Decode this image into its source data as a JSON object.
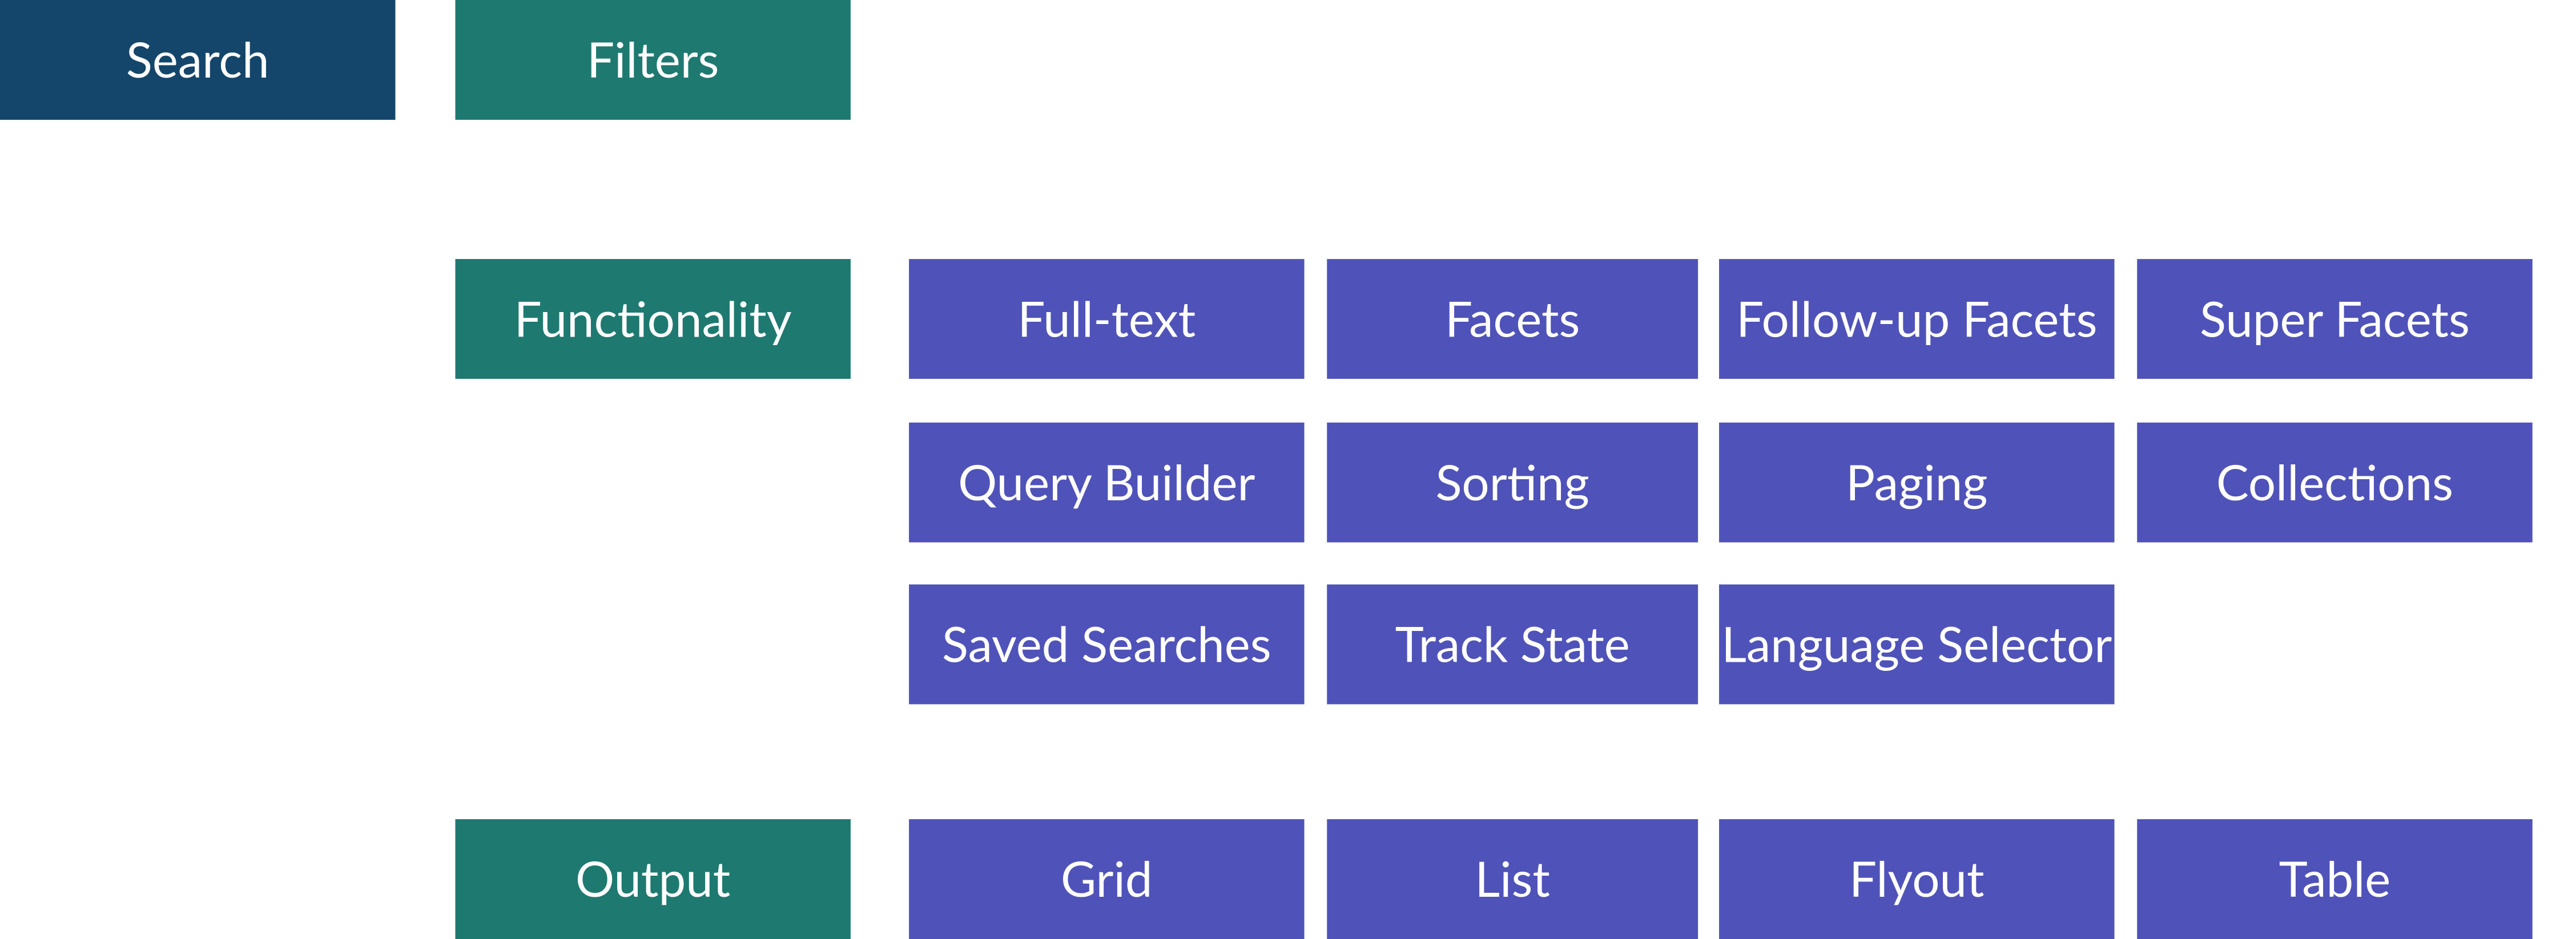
{
  "colors": {
    "navy": "#14456b",
    "teal": "#1e7a70",
    "indigo": "#4f53b9"
  },
  "root": {
    "label": "Search"
  },
  "group": {
    "label": "Filters"
  },
  "sections": {
    "functionality": {
      "label": "Functionality",
      "items": [
        "Full-text",
        "Facets",
        "Follow-up Facets",
        "Super Facets",
        "Query Builder",
        "Sorting",
        "Paging",
        "Collections",
        "Saved Searches",
        "Track State",
        "Language Selector"
      ]
    },
    "output": {
      "label": "Output",
      "items": [
        "Grid",
        "List",
        "Flyout",
        "Table"
      ]
    }
  }
}
